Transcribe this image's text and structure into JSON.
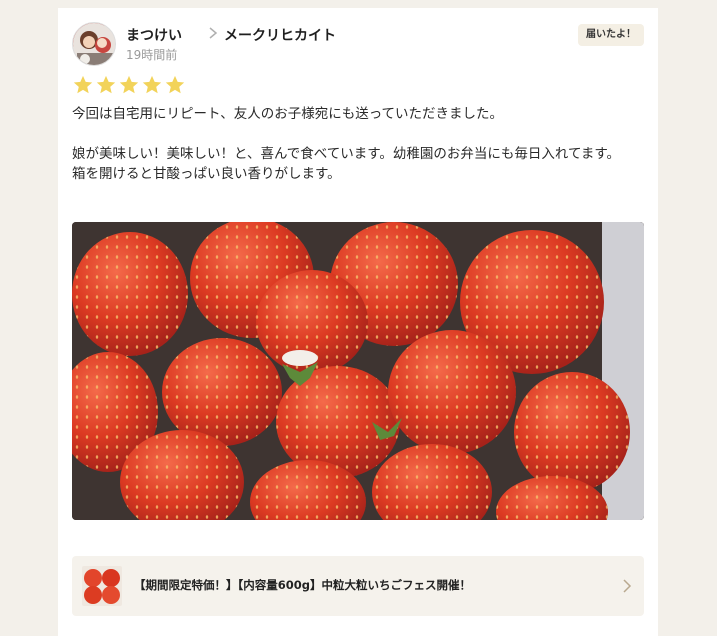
{
  "review": {
    "user_name": "まつけい",
    "shop_name": "メークリヒカイト",
    "timestamp": "19時間前",
    "badge": "届いたよ！",
    "rating": 5,
    "text": "今回は自宅用にリピート、友人のお子様宛にも送っていただきました。\n\n娘が美味しい！美味しい！と、喜んで食べています。幼稚園のお弁当にも毎日入れてます。\n箱を開けると甘酸っぱい良い香りがします。"
  },
  "product": {
    "title": "【期間限定特価！】【内容量600g】中粒大粒いちごフェス開催！"
  },
  "colors": {
    "star": "#f2d35a",
    "strawberry": "#d8361f",
    "background": "#f3f0ea",
    "card": "#ffffff",
    "badge_bg": "#f4efe4",
    "link_bg": "#f5f2ec"
  },
  "icons": {
    "chevron": "chevron-right-icon",
    "star": "star-icon",
    "arrow": "arrow-right-icon"
  }
}
